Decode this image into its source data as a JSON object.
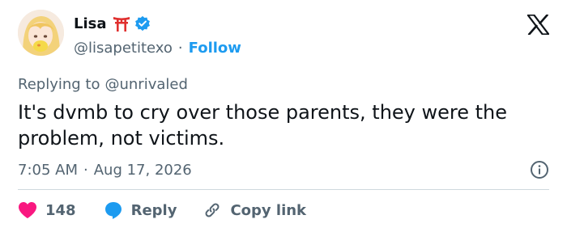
{
  "user": {
    "name": "Lisa",
    "emoji": "torii-gate",
    "verified_icon": "verified-badge-icon",
    "handle": "@lisapetitexo",
    "separator": "·",
    "follow_label": "Follow"
  },
  "platform_logo": "x-logo-icon",
  "tweet": {
    "replying_label": "Replying to",
    "replying_to": "@unrivaled",
    "text": "It's dvmb to cry over those parents, they were the problem, not victims.",
    "time": "7:05 AM",
    "separator": "·",
    "date": "Aug 17, 2026"
  },
  "actions": {
    "like_count": "148",
    "reply_label": "Reply",
    "copy_label": "Copy link"
  },
  "colors": {
    "accent": "#1d9bf0",
    "like": "#f91880",
    "secondary_text": "#536471",
    "divider": "#cfd9de"
  }
}
